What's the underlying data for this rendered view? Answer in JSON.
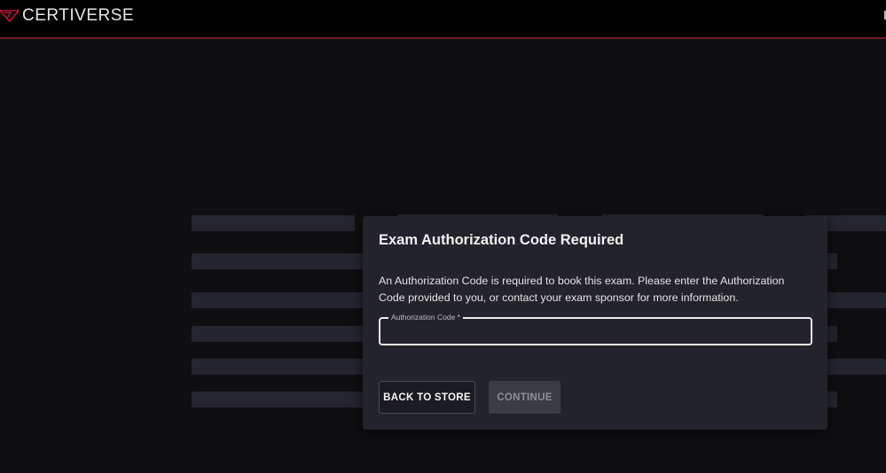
{
  "header": {
    "logo_text": "CERTIVERSE"
  },
  "modal": {
    "title": "Exam Authorization Code Required",
    "body": "An Authorization Code is required to book this exam. Please enter the Authorization Code provided to you, or contact your exam sponsor for more information.",
    "field": {
      "label": "Authorization Code *",
      "value": "",
      "placeholder": ""
    },
    "buttons": {
      "back_label": "BACK TO STORE",
      "continue_label": "CONTINUE",
      "continue_disabled": true
    }
  },
  "colors": {
    "background": "#0f0f12",
    "header": "#000000",
    "header_accent": "#6e1a2a",
    "modal": "#23232b",
    "logo_mark": "#c2183a"
  }
}
